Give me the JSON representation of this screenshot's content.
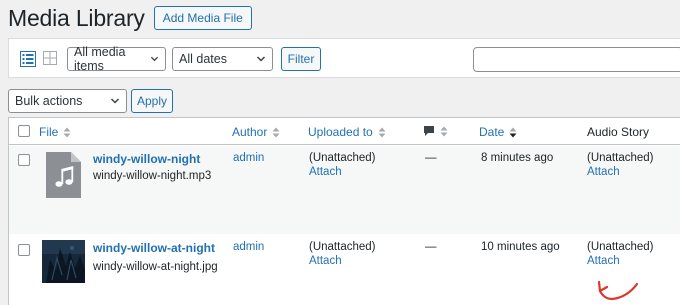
{
  "header": {
    "title": "Media Library",
    "add_button": "Add Media File"
  },
  "toolbar": {
    "media_type_select": "All media items",
    "date_select": "All dates",
    "filter_button": "Filter",
    "search_value": ""
  },
  "bulk": {
    "select": "Bulk actions",
    "apply_button": "Apply"
  },
  "table": {
    "columns": {
      "file": "File",
      "author": "Author",
      "uploaded_to": "Uploaded to",
      "date": "Date",
      "audio_story": "Audio Story"
    },
    "rows": [
      {
        "title": "windy-willow-night",
        "filename": "windy-willow-night.mp3",
        "author": "admin",
        "uploaded_to": "(Unattached)",
        "attach": "Attach",
        "comments": "—",
        "date": "8 minutes ago",
        "audio_story": "(Unattached)",
        "audio_attach": "Attach"
      },
      {
        "title": "windy-willow-at-night",
        "filename": "windy-willow-at-night.jpg",
        "author": "admin",
        "uploaded_to": "(Unattached)",
        "attach": "Attach",
        "comments": "—",
        "date": "10 minutes ago",
        "audio_story": "(Unattached)",
        "audio_attach": "Attach"
      }
    ]
  },
  "icons": {
    "list_view": "list-view-icon",
    "grid_view": "grid-view-icon",
    "comments": "comment-bubble-icon",
    "audio_file": "music-note-icon",
    "annotation": "red-arrow-icon"
  },
  "colors": {
    "link": "#2271b1",
    "annotation": "#e0352b",
    "row_alt": "#f6f7f7"
  }
}
